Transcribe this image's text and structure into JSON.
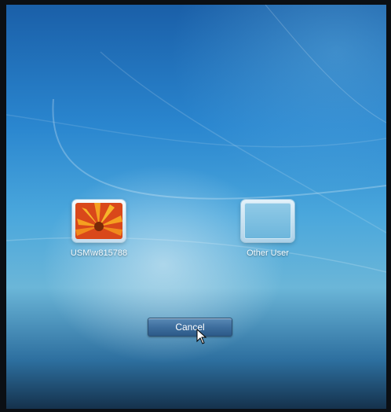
{
  "accounts": [
    {
      "name": "USM\\w815788",
      "icon": "flower-avatar-icon"
    },
    {
      "name": "Other User",
      "icon": "blank-avatar-icon"
    }
  ],
  "cancel_label": "Cancel",
  "colors": {
    "background_top": "#1a5fa8",
    "background_mid": "#4aa7dc",
    "button": "#3e6e9e",
    "flower_orange": "#f07a1a"
  }
}
